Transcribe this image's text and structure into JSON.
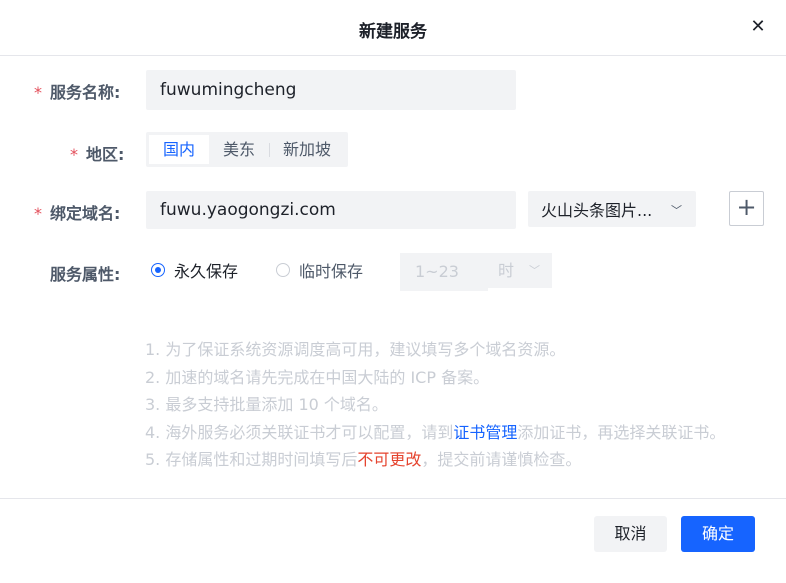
{
  "dialog": {
    "title": "新建服务",
    "close_icon": "close-icon"
  },
  "form": {
    "service_name": {
      "required_mark": "*",
      "label": "服务名称:",
      "value": "fuwumingcheng"
    },
    "region": {
      "required_mark": "*",
      "label": "地区:",
      "options": [
        "国内",
        "美东",
        "新加坡"
      ],
      "selected": "国内"
    },
    "domain": {
      "required_mark": "*",
      "label": "绑定域名:",
      "value": "fuwu.yaogongzi.com",
      "select_value": "火山头条图片...",
      "add_button": "+"
    },
    "attribute": {
      "label": "服务属性:",
      "option_permanent": "永久保存",
      "option_temporary": "临时保存",
      "selected": "永久保存",
      "time_range": "1~23",
      "time_unit": "时"
    }
  },
  "tips": {
    "line1": "1. 为了保证系统资源调度高可用，建议填写多个域名资源。",
    "line2": "2. 加速的域名请先完成在中国大陆的 ICP 备案。",
    "line3": "3. 最多支持批量添加 10 个域名。",
    "line4_prefix": "4. 海外服务必须关联证书才可以配置，请到",
    "line4_link": "证书管理",
    "line4_suffix": "添加证书，再选择关联证书。",
    "line5_prefix": "5. 存储属性和过期时间填写后",
    "line5_warn": "不可更改",
    "line5_suffix": "，提交前请谨慎检查。"
  },
  "footer": {
    "cancel_label": "取消",
    "confirm_label": "确定"
  },
  "colors": {
    "primary": "#1664ff",
    "required": "#e34d59",
    "warning": "#e5442f",
    "input_bg": "#f2f3f5"
  }
}
